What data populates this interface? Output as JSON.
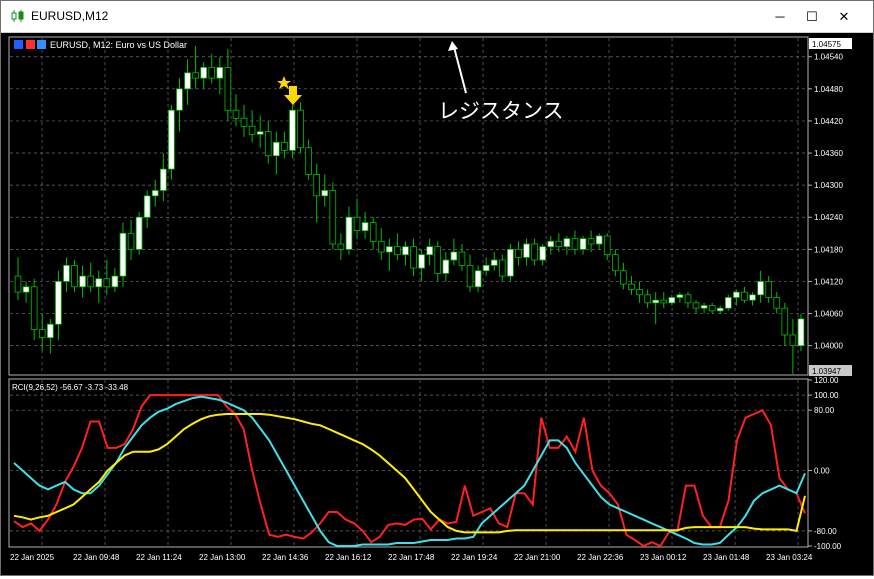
{
  "window": {
    "title": "EURUSD,M12",
    "minimize_glyph": "─",
    "maximize_glyph": "☐",
    "close_glyph": "✕"
  },
  "colors": {
    "background": "#000000",
    "grid": "#6e6e6e",
    "bull_candle": "#ffffff",
    "bear_candle": "#000000",
    "wick": "#00c000",
    "rci_short": "#ff2020",
    "rci_mid": "#40e0e8",
    "rci_long": "#ffee00",
    "annotation": "#ffffff",
    "signal": "#ffd800"
  },
  "main_chart": {
    "header": "EURUSD, M12:  Euro vs US Dollar",
    "current_price_label": "1.04575",
    "last_price_label": "1.03947",
    "annotation_text": "レジスタンス",
    "signal_icons": [
      "star-icon",
      "down-arrow-icon"
    ],
    "price_ticks": [
      "1.04540",
      "1.04480",
      "1.04420",
      "1.04360",
      "1.04300",
      "1.04240",
      "1.04180",
      "1.04120",
      "1.04060",
      "1.04000"
    ]
  },
  "indicator": {
    "header": "RCI(9,26,52) -56.67 -3.73 -33.48",
    "level_labels": [
      "120.00",
      "100.00",
      "80.00",
      "0.00",
      "-80.00",
      "-100.00"
    ]
  },
  "time_axis": [
    "22 Jan 2025",
    "22 Jan 09:48",
    "22 Jan 11:24",
    "22 Jan 13:00",
    "22 Jan 14:36",
    "22 Jan 16:12",
    "22 Jan 17:48",
    "22 Jan 19:24",
    "22 Jan 21:00",
    "22 Jan 22:36",
    "23 Jan 00:12",
    "23 Jan 01:48",
    "23 Jan 03:24"
  ],
  "chart_data": {
    "type": "candlestick",
    "symbol": "EURUSD",
    "timeframe": "M12",
    "ylim": [
      1.03947,
      1.04575
    ],
    "candles": [
      {
        "o": 1.0413,
        "h": 1.04165,
        "l": 1.04085,
        "c": 1.041
      },
      {
        "o": 1.041,
        "h": 1.0412,
        "l": 1.0408,
        "c": 1.0411
      },
      {
        "o": 1.0411,
        "h": 1.04125,
        "l": 1.0401,
        "c": 1.0403
      },
      {
        "o": 1.0403,
        "h": 1.0406,
        "l": 1.0399,
        "c": 1.04015
      },
      {
        "o": 1.04015,
        "h": 1.0405,
        "l": 1.03985,
        "c": 1.0404
      },
      {
        "o": 1.0404,
        "h": 1.0414,
        "l": 1.0401,
        "c": 1.0412
      },
      {
        "o": 1.0412,
        "h": 1.04165,
        "l": 1.041,
        "c": 1.0415
      },
      {
        "o": 1.0415,
        "h": 1.0416,
        "l": 1.041,
        "c": 1.0411
      },
      {
        "o": 1.0411,
        "h": 1.0415,
        "l": 1.0409,
        "c": 1.0413
      },
      {
        "o": 1.0413,
        "h": 1.04155,
        "l": 1.041,
        "c": 1.0411
      },
      {
        "o": 1.0411,
        "h": 1.0414,
        "l": 1.0408,
        "c": 1.04125
      },
      {
        "o": 1.04125,
        "h": 1.0416,
        "l": 1.04095,
        "c": 1.0411
      },
      {
        "o": 1.0411,
        "h": 1.04145,
        "l": 1.041,
        "c": 1.0413
      },
      {
        "o": 1.0413,
        "h": 1.0423,
        "l": 1.0411,
        "c": 1.0421
      },
      {
        "o": 1.0421,
        "h": 1.04235,
        "l": 1.0416,
        "c": 1.0418
      },
      {
        "o": 1.0418,
        "h": 1.0425,
        "l": 1.0417,
        "c": 1.0424
      },
      {
        "o": 1.0424,
        "h": 1.0429,
        "l": 1.0422,
        "c": 1.0428
      },
      {
        "o": 1.0428,
        "h": 1.0431,
        "l": 1.0426,
        "c": 1.0429
      },
      {
        "o": 1.0429,
        "h": 1.0436,
        "l": 1.0427,
        "c": 1.0433
      },
      {
        "o": 1.0433,
        "h": 1.0445,
        "l": 1.0431,
        "c": 1.0444
      },
      {
        "o": 1.0444,
        "h": 1.045,
        "l": 1.044,
        "c": 1.0448
      },
      {
        "o": 1.0448,
        "h": 1.04535,
        "l": 1.0445,
        "c": 1.0451
      },
      {
        "o": 1.0451,
        "h": 1.0456,
        "l": 1.0448,
        "c": 1.045
      },
      {
        "o": 1.045,
        "h": 1.0453,
        "l": 1.0448,
        "c": 1.0452
      },
      {
        "o": 1.0452,
        "h": 1.04545,
        "l": 1.0449,
        "c": 1.045
      },
      {
        "o": 1.045,
        "h": 1.0454,
        "l": 1.0447,
        "c": 1.0452
      },
      {
        "o": 1.0452,
        "h": 1.04555,
        "l": 1.0442,
        "c": 1.0444
      },
      {
        "o": 1.0444,
        "h": 1.0447,
        "l": 1.0441,
        "c": 1.04425
      },
      {
        "o": 1.04425,
        "h": 1.0445,
        "l": 1.0439,
        "c": 1.0441
      },
      {
        "o": 1.0441,
        "h": 1.0444,
        "l": 1.0438,
        "c": 1.04395
      },
      {
        "o": 1.04395,
        "h": 1.0443,
        "l": 1.0437,
        "c": 1.044
      },
      {
        "o": 1.044,
        "h": 1.0442,
        "l": 1.0434,
        "c": 1.04355
      },
      {
        "o": 1.04355,
        "h": 1.044,
        "l": 1.0432,
        "c": 1.0438
      },
      {
        "o": 1.0438,
        "h": 1.044,
        "l": 1.0435,
        "c": 1.04365
      },
      {
        "o": 1.04365,
        "h": 1.0445,
        "l": 1.0435,
        "c": 1.0444
      },
      {
        "o": 1.0444,
        "h": 1.04455,
        "l": 1.0436,
        "c": 1.0437
      },
      {
        "o": 1.0437,
        "h": 1.04385,
        "l": 1.0431,
        "c": 1.0432
      },
      {
        "o": 1.0432,
        "h": 1.0434,
        "l": 1.0423,
        "c": 1.0428
      },
      {
        "o": 1.0428,
        "h": 1.0432,
        "l": 1.0426,
        "c": 1.0429
      },
      {
        "o": 1.0429,
        "h": 1.04305,
        "l": 1.0418,
        "c": 1.0419
      },
      {
        "o": 1.0419,
        "h": 1.0421,
        "l": 1.0416,
        "c": 1.0418
      },
      {
        "o": 1.0418,
        "h": 1.0426,
        "l": 1.0417,
        "c": 1.0424
      },
      {
        "o": 1.0424,
        "h": 1.04275,
        "l": 1.042,
        "c": 1.04215
      },
      {
        "o": 1.04215,
        "h": 1.0425,
        "l": 1.042,
        "c": 1.0423
      },
      {
        "o": 1.0423,
        "h": 1.0424,
        "l": 1.0418,
        "c": 1.04195
      },
      {
        "o": 1.04195,
        "h": 1.0422,
        "l": 1.0416,
        "c": 1.04175
      },
      {
        "o": 1.04175,
        "h": 1.042,
        "l": 1.0414,
        "c": 1.04185
      },
      {
        "o": 1.04185,
        "h": 1.0421,
        "l": 1.0416,
        "c": 1.0417
      },
      {
        "o": 1.0417,
        "h": 1.04195,
        "l": 1.0415,
        "c": 1.04185
      },
      {
        "o": 1.04185,
        "h": 1.042,
        "l": 1.0413,
        "c": 1.04145
      },
      {
        "o": 1.04145,
        "h": 1.0418,
        "l": 1.0412,
        "c": 1.0417
      },
      {
        "o": 1.0417,
        "h": 1.042,
        "l": 1.0415,
        "c": 1.04185
      },
      {
        "o": 1.04185,
        "h": 1.04195,
        "l": 1.0412,
        "c": 1.04135
      },
      {
        "o": 1.04135,
        "h": 1.04175,
        "l": 1.0412,
        "c": 1.0416
      },
      {
        "o": 1.0416,
        "h": 1.042,
        "l": 1.0415,
        "c": 1.04175
      },
      {
        "o": 1.04175,
        "h": 1.0419,
        "l": 1.0414,
        "c": 1.0415
      },
      {
        "o": 1.0415,
        "h": 1.0417,
        "l": 1.041,
        "c": 1.0411
      },
      {
        "o": 1.0411,
        "h": 1.0415,
        "l": 1.041,
        "c": 1.0414
      },
      {
        "o": 1.0414,
        "h": 1.04165,
        "l": 1.0413,
        "c": 1.0415
      },
      {
        "o": 1.0415,
        "h": 1.04175,
        "l": 1.0414,
        "c": 1.0416
      },
      {
        "o": 1.0416,
        "h": 1.0417,
        "l": 1.0412,
        "c": 1.0413
      },
      {
        "o": 1.0413,
        "h": 1.0419,
        "l": 1.0412,
        "c": 1.0418
      },
      {
        "o": 1.0418,
        "h": 1.04195,
        "l": 1.0415,
        "c": 1.04165
      },
      {
        "o": 1.04165,
        "h": 1.042,
        "l": 1.0415,
        "c": 1.0419
      },
      {
        "o": 1.0419,
        "h": 1.042,
        "l": 1.0415,
        "c": 1.0416
      },
      {
        "o": 1.0416,
        "h": 1.0419,
        "l": 1.0415,
        "c": 1.04185
      },
      {
        "o": 1.04185,
        "h": 1.04205,
        "l": 1.0417,
        "c": 1.04195
      },
      {
        "o": 1.04195,
        "h": 1.0421,
        "l": 1.04175,
        "c": 1.04185
      },
      {
        "o": 1.04185,
        "h": 1.04205,
        "l": 1.0417,
        "c": 1.042
      },
      {
        "o": 1.042,
        "h": 1.04215,
        "l": 1.0417,
        "c": 1.0418
      },
      {
        "o": 1.0418,
        "h": 1.04205,
        "l": 1.0417,
        "c": 1.042
      },
      {
        "o": 1.042,
        "h": 1.04215,
        "l": 1.04175,
        "c": 1.0419
      },
      {
        "o": 1.0419,
        "h": 1.0421,
        "l": 1.0418,
        "c": 1.04205
      },
      {
        "o": 1.04205,
        "h": 1.0421,
        "l": 1.0416,
        "c": 1.0417
      },
      {
        "o": 1.0417,
        "h": 1.0418,
        "l": 1.0413,
        "c": 1.0414
      },
      {
        "o": 1.0414,
        "h": 1.04155,
        "l": 1.04105,
        "c": 1.04115
      },
      {
        "o": 1.04115,
        "h": 1.0413,
        "l": 1.04095,
        "c": 1.04105
      },
      {
        "o": 1.04105,
        "h": 1.0412,
        "l": 1.0408,
        "c": 1.04095
      },
      {
        "o": 1.04095,
        "h": 1.04105,
        "l": 1.0407,
        "c": 1.0408
      },
      {
        "o": 1.0408,
        "h": 1.041,
        "l": 1.0404,
        "c": 1.04085
      },
      {
        "o": 1.04085,
        "h": 1.041,
        "l": 1.0407,
        "c": 1.0408
      },
      {
        "o": 1.0408,
        "h": 1.04095,
        "l": 1.04075,
        "c": 1.0409
      },
      {
        "o": 1.0409,
        "h": 1.041,
        "l": 1.0408,
        "c": 1.04095
      },
      {
        "o": 1.04095,
        "h": 1.041,
        "l": 1.0407,
        "c": 1.0408
      },
      {
        "o": 1.0408,
        "h": 1.04085,
        "l": 1.0406,
        "c": 1.0407
      },
      {
        "o": 1.0407,
        "h": 1.0408,
        "l": 1.0406,
        "c": 1.04075
      },
      {
        "o": 1.04075,
        "h": 1.0408,
        "l": 1.0406,
        "c": 1.04065
      },
      {
        "o": 1.04065,
        "h": 1.04075,
        "l": 1.0406,
        "c": 1.0407
      },
      {
        "o": 1.0407,
        "h": 1.04095,
        "l": 1.04065,
        "c": 1.0409
      },
      {
        "o": 1.0409,
        "h": 1.04105,
        "l": 1.04075,
        "c": 1.041
      },
      {
        "o": 1.041,
        "h": 1.0411,
        "l": 1.0408,
        "c": 1.04085
      },
      {
        "o": 1.04085,
        "h": 1.041,
        "l": 1.04075,
        "c": 1.04095
      },
      {
        "o": 1.04095,
        "h": 1.0414,
        "l": 1.0408,
        "c": 1.0412
      },
      {
        "o": 1.0412,
        "h": 1.0413,
        "l": 1.0408,
        "c": 1.0409
      },
      {
        "o": 1.0409,
        "h": 1.041,
        "l": 1.0406,
        "c": 1.0407
      },
      {
        "o": 1.0407,
        "h": 1.0408,
        "l": 1.04,
        "c": 1.0402
      },
      {
        "o": 1.0402,
        "h": 1.0405,
        "l": 1.03947,
        "c": 1.04
      },
      {
        "o": 1.04,
        "h": 1.0406,
        "l": 1.0399,
        "c": 1.0405
      }
    ],
    "rci_series": [
      {
        "name": "RCI 9",
        "value_label": "-56.67",
        "color": "#ff2020",
        "values": [
          -67,
          -75,
          -70,
          -80,
          -65,
          -45,
          -15,
          5,
          30,
          65,
          65,
          30,
          30,
          35,
          55,
          85,
          100,
          100,
          100,
          100,
          100,
          100,
          100,
          100,
          100,
          85,
          75,
          55,
          0,
          -45,
          -85,
          -88,
          -85,
          -88,
          -90,
          -82,
          -70,
          -55,
          -55,
          -65,
          -70,
          -80,
          -95,
          -88,
          -72,
          -70,
          -72,
          -65,
          -64,
          -78,
          -65,
          -70,
          -68,
          -20,
          -60,
          -55,
          -50,
          -70,
          -75,
          -30,
          -30,
          -45,
          70,
          30,
          30,
          45,
          25,
          70,
          0,
          -20,
          -30,
          -45,
          -85,
          -92,
          -100,
          -95,
          -100,
          -82,
          -80,
          -20,
          -20,
          -60,
          -75,
          -75,
          -40,
          40,
          70,
          75,
          80,
          60,
          -10,
          -25,
          -30,
          -56.67
        ]
      },
      {
        "name": "RCI 26",
        "value_label": "-3.73",
        "color": "#40e0e8",
        "values": [
          10,
          0,
          -10,
          -20,
          -25,
          -20,
          -15,
          -25,
          -30,
          -30,
          -20,
          -5,
          10,
          30,
          45,
          60,
          70,
          78,
          82,
          88,
          92,
          96,
          98,
          96,
          94,
          90,
          85,
          80,
          70,
          55,
          40,
          20,
          0,
          -20,
          -40,
          -60,
          -80,
          -95,
          -100,
          -100,
          -100,
          -98,
          -98,
          -98,
          -98,
          -96,
          -96,
          -96,
          -94,
          -92,
          -92,
          -92,
          -90,
          -90,
          -88,
          -70,
          -60,
          -50,
          -40,
          -30,
          -20,
          0,
          20,
          40,
          40,
          30,
          10,
          -5,
          -20,
          -35,
          -45,
          -50,
          -55,
          -60,
          -65,
          -70,
          -75,
          -80,
          -85,
          -90,
          -96,
          -98,
          -98,
          -96,
          -85,
          -75,
          -60,
          -40,
          -30,
          -25,
          -20,
          -25,
          -30,
          -3.73
        ]
      },
      {
        "name": "RCI 52",
        "value_label": "-33.48",
        "color": "#ffee00",
        "values": [
          -60,
          -62,
          -65,
          -62,
          -60,
          -55,
          -50,
          -45,
          -35,
          -25,
          -15,
          0,
          10,
          20,
          25,
          25,
          25,
          28,
          35,
          45,
          55,
          62,
          68,
          72,
          74,
          75,
          75,
          75,
          75,
          75,
          74,
          72,
          70,
          68,
          65,
          62,
          60,
          55,
          50,
          45,
          40,
          35,
          28,
          20,
          10,
          0,
          -10,
          -25,
          -40,
          -55,
          -65,
          -75,
          -80,
          -82,
          -82,
          -82,
          -82,
          -82,
          -80,
          -79,
          -79,
          -79,
          -79,
          -79,
          -79,
          -79,
          -79,
          -79,
          -79,
          -79,
          -79,
          -79,
          -79,
          -79,
          -79,
          -79,
          -79,
          -79,
          -79,
          -76,
          -75,
          -75,
          -75,
          -75,
          -75,
          -75,
          -75,
          -77,
          -78,
          -78,
          -78,
          -78,
          -80,
          -33.48
        ]
      }
    ],
    "rci_ylim": [
      -100,
      120
    ]
  }
}
